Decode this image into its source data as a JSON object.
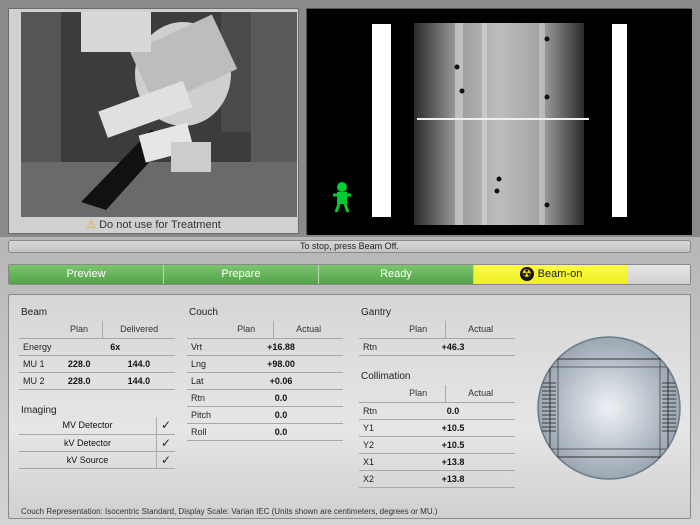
{
  "camera": {
    "caption": "Do not use for Treatment",
    "warning_icon": "warning-icon"
  },
  "status_bar": {
    "text": "To stop, press Beam Off."
  },
  "workflow": {
    "steps": [
      {
        "label": "Preview",
        "state": "done"
      },
      {
        "label": "Prepare",
        "state": "done"
      },
      {
        "label": "Ready",
        "state": "done"
      },
      {
        "label": "Beam-on",
        "state": "active",
        "icon": "radiation-icon"
      }
    ]
  },
  "beam": {
    "title": "Beam",
    "col_plan": "Plan",
    "col_delivered": "Delivered",
    "energy_label": "Energy",
    "energy_value": "6x",
    "mu1_label": "MU 1",
    "mu1_plan": "228.0",
    "mu1_delivered": "144.0",
    "mu2_label": "MU 2",
    "mu2_plan": "228.0",
    "mu2_delivered": "144.0"
  },
  "imaging": {
    "title": "Imaging",
    "items": [
      {
        "label": "MV Detector",
        "checked": "✓"
      },
      {
        "label": "kV Detector",
        "checked": "✓"
      },
      {
        "label": "kV Source",
        "checked": "✓"
      }
    ]
  },
  "couch": {
    "title": "Couch",
    "col_plan": "Plan",
    "col_actual": "Actual",
    "rows": [
      {
        "label": "Vrt",
        "value": "+16.88"
      },
      {
        "label": "Lng",
        "value": "+98.00"
      },
      {
        "label": "Lat",
        "value": "+0.06"
      },
      {
        "label": "Rtn",
        "value": "0.0"
      },
      {
        "label": "Pitch",
        "value": "0.0"
      },
      {
        "label": "Roll",
        "value": "0.0"
      }
    ]
  },
  "gantry": {
    "title": "Gantry",
    "col_plan": "Plan",
    "col_actual": "Actual",
    "rtn_label": "Rtn",
    "rtn_value": "+46.3"
  },
  "collimation": {
    "title": "Collimation",
    "col_plan": "Plan",
    "col_actual": "Actual",
    "rows": [
      {
        "label": "Rtn",
        "value": "0.0"
      },
      {
        "label": "Y1",
        "value": "+10.5"
      },
      {
        "label": "Y2",
        "value": "+10.5"
      },
      {
        "label": "X1",
        "value": "+13.8"
      },
      {
        "label": "X2",
        "value": "+13.8"
      }
    ]
  },
  "footnote": "Couch Representation: Isocentric Standard, Display Scale: Varian IEC (Units shown are centimeters, degrees or MU.)",
  "colors": {
    "done": "#5fb152",
    "active": "#f6f632",
    "patient_icon": "#00cc33"
  }
}
